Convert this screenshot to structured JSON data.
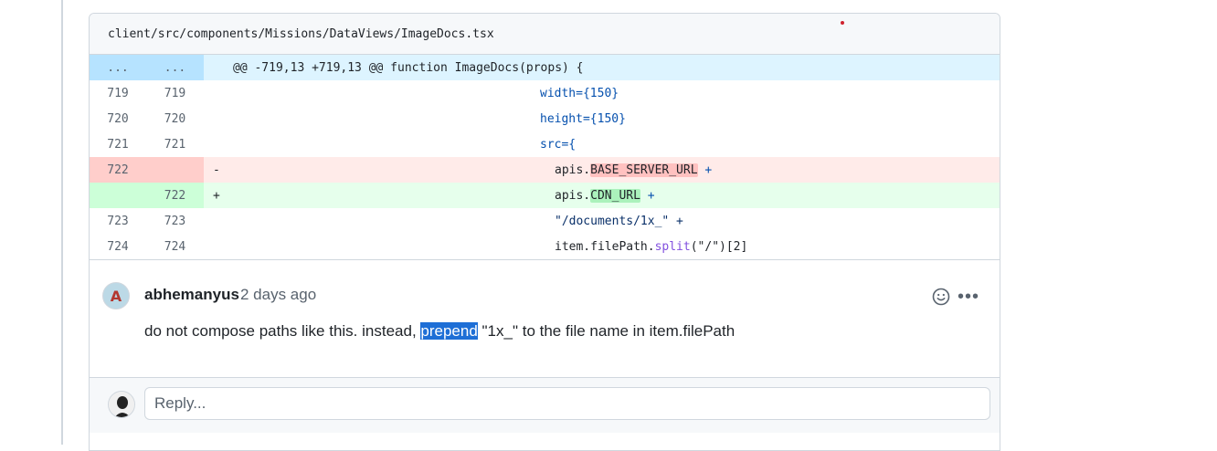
{
  "file": {
    "path": "client/src/components/Missions/DataViews/ImageDocs.tsx"
  },
  "hunk": {
    "old_marker": "...",
    "new_marker": "...",
    "header": "@@ -719,13 +719,13 @@ function ImageDocs(props) {"
  },
  "lines": [
    {
      "old": "719",
      "new": "719",
      "type": "context",
      "code": "width={150}"
    },
    {
      "old": "720",
      "new": "720",
      "type": "context",
      "code": "height={150}"
    },
    {
      "old": "721",
      "new": "721",
      "type": "context",
      "code": "src={"
    },
    {
      "old": "722",
      "new": "",
      "type": "del",
      "sign": "-",
      "prefix": "apis.",
      "highlight": "BASE_SERVER_URL",
      "suffix": " +"
    },
    {
      "old": "",
      "new": "722",
      "type": "add",
      "sign": "+",
      "prefix": "apis.",
      "highlight": "CDN_URL",
      "suffix": " +"
    },
    {
      "old": "723",
      "new": "723",
      "type": "context",
      "code": "\"/documents/1x_\" +"
    },
    {
      "old": "724",
      "new": "724",
      "type": "context",
      "prefix": "item.filePath.",
      "fn": "split",
      "suffix": "(\"/\")[2]"
    }
  ],
  "comment": {
    "author": "abhemanyus",
    "time": "2 days ago",
    "body_before": "do not compose paths like this. instead, ",
    "body_selected": "prepend",
    "body_after": " \"1x_\" to the file name in item.filePath",
    "avatar_letter": "A",
    "more_label": "•••"
  },
  "reply": {
    "placeholder": "Reply..."
  },
  "icons": {
    "emoji": "smiley-icon",
    "more": "kebab-horizontal-icon"
  },
  "colors": {
    "del_bg": "#ffebe9",
    "add_bg": "#e6ffec",
    "hunk_bg": "#ddf4ff",
    "selection": "#1e6fd6"
  }
}
